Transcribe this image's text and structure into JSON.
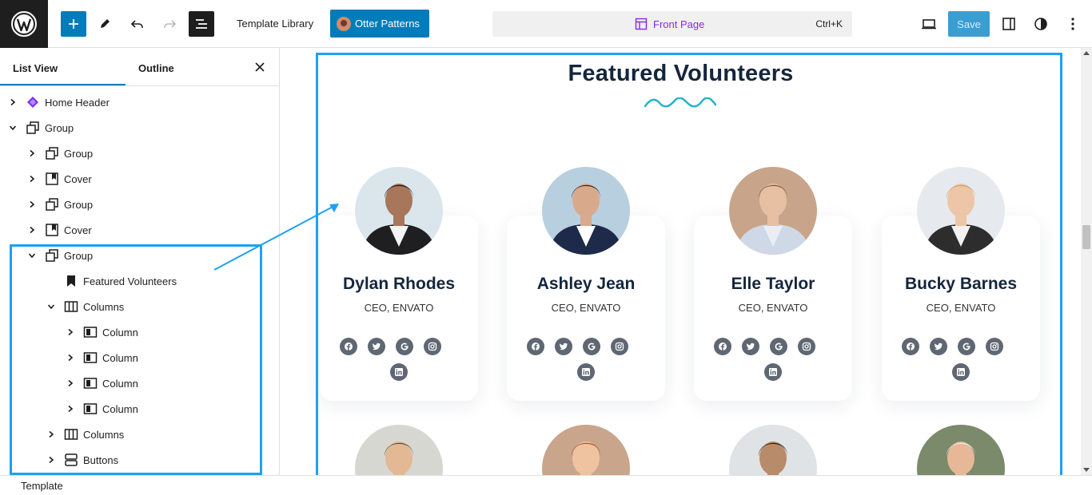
{
  "toolbar": {
    "template_library": "Template Library",
    "otter_patterns": "Otter Patterns",
    "document_title": "Front Page",
    "shortcut": "Ctrl+K",
    "save": "Save"
  },
  "sidebar": {
    "tabs": [
      "List View",
      "Outline"
    ],
    "active_tab": "List View",
    "tree": [
      {
        "label": "Home Header",
        "icon": "template-part-icon",
        "expanded": false,
        "depth": 0
      },
      {
        "label": "Group",
        "icon": "group-icon",
        "expanded": true,
        "depth": 0
      },
      {
        "label": "Group",
        "icon": "group-icon",
        "expanded": false,
        "depth": 1
      },
      {
        "label": "Cover",
        "icon": "cover-icon",
        "expanded": false,
        "depth": 1
      },
      {
        "label": "Group",
        "icon": "group-icon",
        "expanded": false,
        "depth": 1
      },
      {
        "label": "Cover",
        "icon": "cover-icon",
        "expanded": false,
        "depth": 1
      },
      {
        "label": "Group",
        "icon": "group-icon",
        "expanded": true,
        "depth": 1
      },
      {
        "label": "Featured Volunteers",
        "icon": "heading-bookmark-icon",
        "expanded": null,
        "depth": 2
      },
      {
        "label": "Columns",
        "icon": "columns-icon",
        "expanded": true,
        "depth": 2
      },
      {
        "label": "Column",
        "icon": "column-icon",
        "expanded": false,
        "depth": 3
      },
      {
        "label": "Column",
        "icon": "column-icon",
        "expanded": false,
        "depth": 3
      },
      {
        "label": "Column",
        "icon": "column-icon",
        "expanded": false,
        "depth": 3
      },
      {
        "label": "Column",
        "icon": "column-icon",
        "expanded": false,
        "depth": 3
      },
      {
        "label": "Columns",
        "icon": "columns-icon",
        "expanded": false,
        "depth": 2
      },
      {
        "label": "Buttons",
        "icon": "buttons-icon",
        "expanded": false,
        "depth": 2
      }
    ]
  },
  "canvas": {
    "section_title": "Featured Volunteers",
    "volunteers": [
      {
        "name": "Dylan Rhodes",
        "role": "CEO, ENVATO"
      },
      {
        "name": "Ashley Jean",
        "role": "CEO, ENVATO"
      },
      {
        "name": "Elle Taylor",
        "role": "CEO, ENVATO"
      },
      {
        "name": "Bucky Barnes",
        "role": "CEO, ENVATO"
      }
    ],
    "social_icons": [
      "facebook-icon",
      "twitter-icon",
      "google-icon",
      "instagram-icon",
      "linkedin-icon"
    ]
  },
  "footer": {
    "breadcrumb": "Template"
  },
  "colors": {
    "accent": "#007cba",
    "highlight": "#1da1f2",
    "title": "#14263c",
    "wave": "#1fb6c9",
    "document_title": "#8a2be2"
  }
}
